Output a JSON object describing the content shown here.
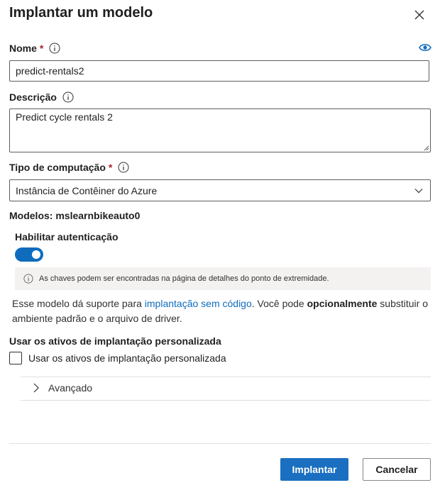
{
  "dialog": {
    "title": "Implantar um modelo",
    "close_icon": "close-icon"
  },
  "name_field": {
    "label": "Nome",
    "required_marker": "*",
    "value": "predict-rentals2",
    "info_icon": "info-icon",
    "visibility_icon": "eye-icon"
  },
  "description_field": {
    "label": "Descrição",
    "value": "Predict cycle rentals 2",
    "info_icon": "info-icon"
  },
  "compute_field": {
    "label": "Tipo de computação",
    "required_marker": "*",
    "selected": "Instância de Contêiner do Azure",
    "info_icon": "info-icon",
    "dropdown_icon": "chevron-down-icon"
  },
  "models_line": "Modelos: mslearnbikeauto0",
  "auth": {
    "label": "Habilitar autenticação",
    "enabled": true,
    "info_text": "As chaves podem ser encontradas na página de detalhes do ponto de extremidade."
  },
  "description_paragraph": {
    "part1": "Esse modelo dá suporte para ",
    "link": "implantação sem código",
    "part2": ". Você pode ",
    "bold": "opcionalmente",
    "part3": " substituir o ambiente padrão e o arquivo de driver."
  },
  "custom_assets": {
    "section_title": "Usar os ativos de implantação personalizada",
    "checkbox_label": "Usar os ativos de implantação personalizada",
    "checked": false
  },
  "advanced": {
    "label": "Avançado",
    "icon": "chevron-right-icon"
  },
  "footer": {
    "deploy_label": "Implantar",
    "cancel_label": "Cancelar"
  },
  "colors": {
    "accent": "#0f6cbd",
    "primary_button": "#1a6fc0",
    "required": "#a4262c",
    "infobar_bg": "#f3f2f1"
  }
}
